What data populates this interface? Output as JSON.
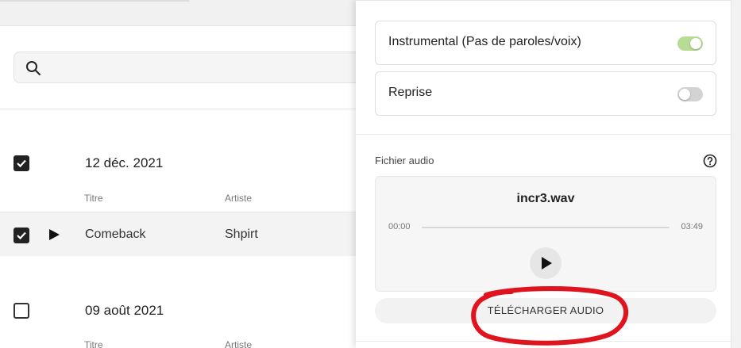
{
  "list": {
    "groups": [
      {
        "date": "12 déc. 2021",
        "checked": true,
        "columns": {
          "title": "Titre",
          "artist": "Artiste"
        },
        "rows": [
          {
            "title": "Comeback",
            "artist": "Shpirt",
            "checked": true
          }
        ]
      },
      {
        "date": "09 août 2021",
        "checked": false,
        "columns": {
          "title": "Titre",
          "artist": "Artiste"
        },
        "rows": []
      }
    ]
  },
  "panel": {
    "instrumental": {
      "label": "Instrumental (Pas de paroles/voix)",
      "on": true
    },
    "cover": {
      "label": "Reprise",
      "on": false
    },
    "audio": {
      "section_label": "Fichier audio",
      "file_name": "incr3.wav",
      "time_current": "00:00",
      "time_total": "03:49",
      "progress": 0,
      "download_label": "TÉLÉCHARGER AUDIO"
    }
  },
  "colors": {
    "toggle_on": "#b6dc95",
    "toggle_off": "#d3d3d3",
    "annotation": "#e0141e"
  }
}
